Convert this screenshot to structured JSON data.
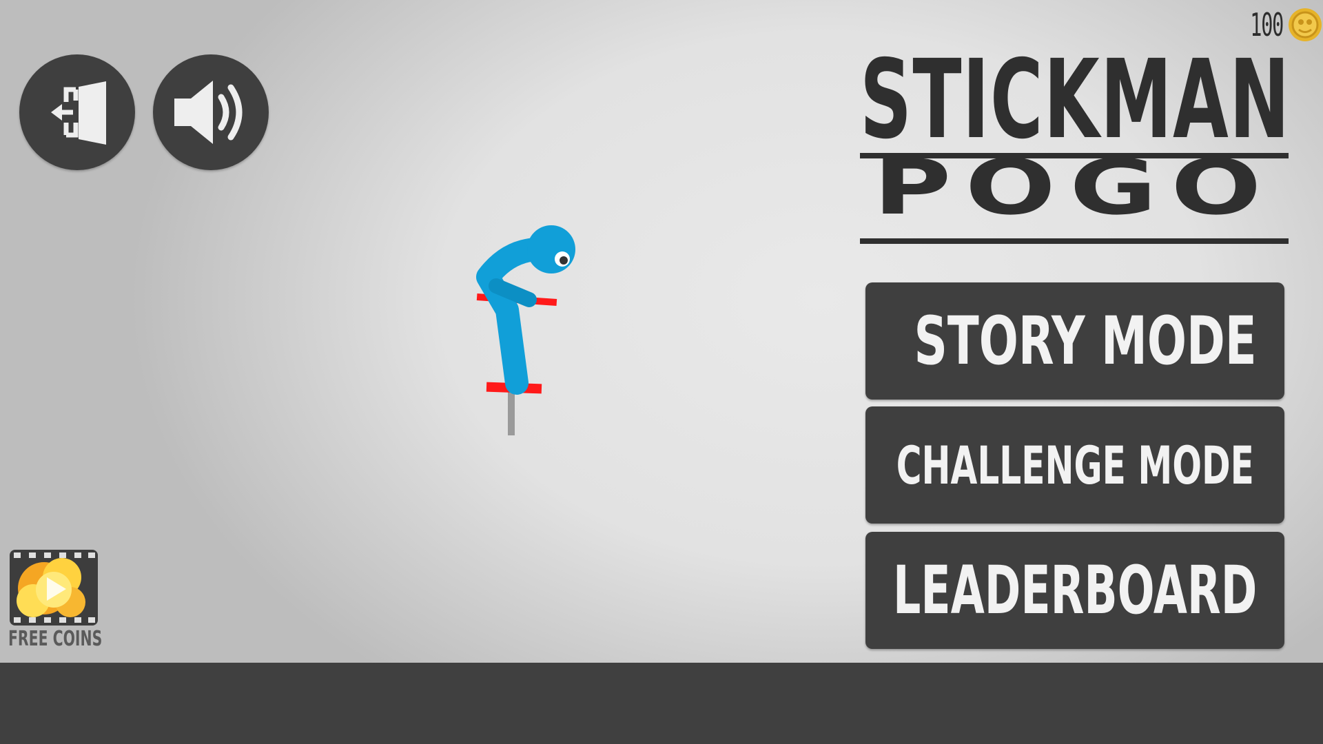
{
  "game": {
    "title_line1": "STICKMAN",
    "title_line2": "POGO"
  },
  "hud": {
    "coins": "100",
    "coin_icon": "coin-icon"
  },
  "controls": {
    "exit_icon": "exit-door-icon",
    "sound_icon": "speaker-on-icon"
  },
  "menu": {
    "story": "STORY MODE",
    "challenge": "CHALLENGE MODE",
    "leaderboard": "LEADERBOARD"
  },
  "bonus": {
    "label": "FREE COINS",
    "icon": "video-reward-icon"
  },
  "colors": {
    "background": "#e4e4e4",
    "panel": "#3f3f3f",
    "ground": "#404040",
    "stickman": "#119fd8",
    "pogo": "#ff1a1a",
    "coin": "#e6b32a"
  }
}
